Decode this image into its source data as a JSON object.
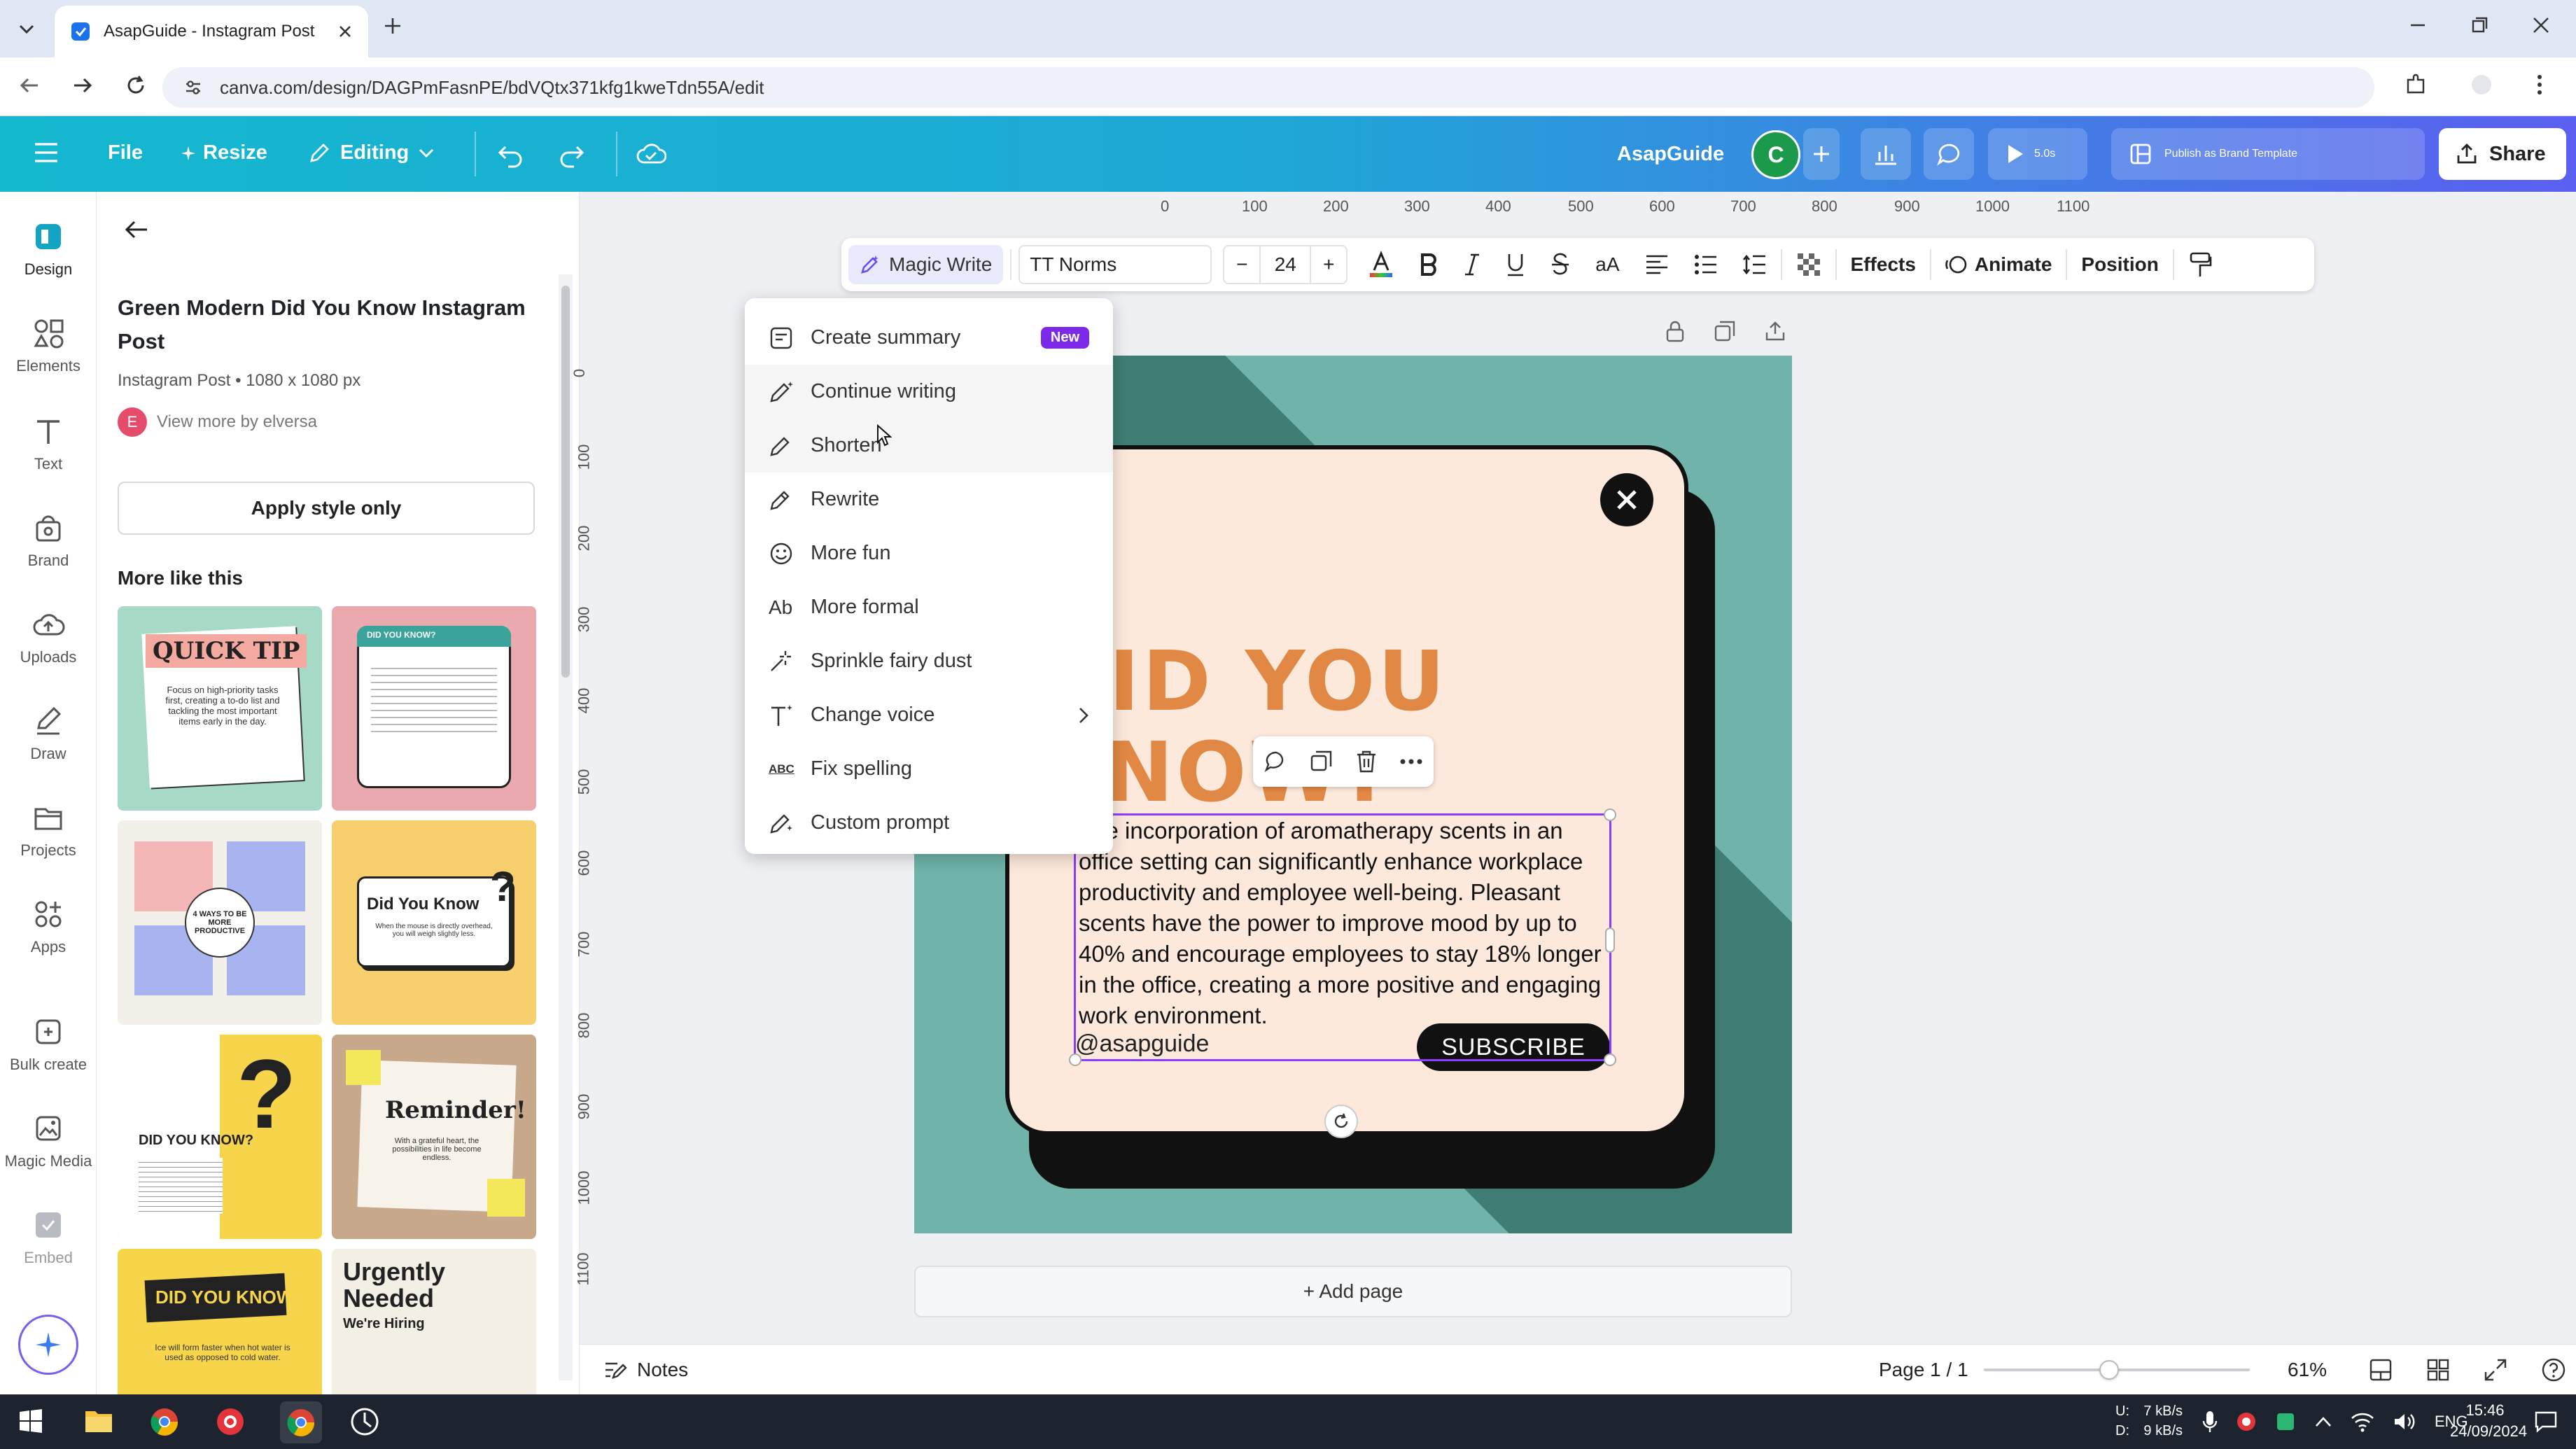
{
  "browser": {
    "tab_title": "AsapGuide - Instagram Post",
    "url": "canva.com/design/DAGPmFasnPE/bdVQtx371kfg1kweTdn55A/edit"
  },
  "header": {
    "file": "File",
    "resize": "Resize",
    "editing": "Editing",
    "brand_name": "AsapGuide",
    "avatar_letter": "C",
    "play_time": "5.0s",
    "publish": "Publish as Brand Template",
    "share": "Share"
  },
  "rail": {
    "items": [
      "Design",
      "Elements",
      "Text",
      "Brand",
      "Uploads",
      "Draw",
      "Projects",
      "Apps",
      "Bulk create",
      "Magic Media",
      "Embed"
    ]
  },
  "panel": {
    "title": "Green Modern Did You Know Instagram Post",
    "subtitle": "Instagram Post • 1080 x 1080 px",
    "author_initial": "E",
    "author": "View more by elversa",
    "apply_style": "Apply style only",
    "more_like_this": "More like this",
    "thumbs": [
      {
        "heading": "QUICK TIP",
        "body": "Focus on high-priority tasks first, creating a to-do list and tackling the most important items early in the day."
      },
      {
        "heading": "DID YOU KNOW?",
        "body": ""
      },
      {
        "heading": "4 WAYS TO BE MORE PRODUCTIVE",
        "body": ""
      },
      {
        "heading": "Did You Know",
        "body": "When the mouse is directly overhead, you will weigh slightly less."
      },
      {
        "heading": "DID YOU KNOW?",
        "body": ""
      },
      {
        "heading": "Reminder!",
        "body": "With a grateful heart, the possibilities in life become endless."
      },
      {
        "heading": "DID YOU KNOW?",
        "body": "Ice will form faster when hot water is used as opposed to cold water."
      },
      {
        "heading": "Urgently Needed",
        "body": "We're Hiring"
      }
    ]
  },
  "ruler": {
    "top": [
      "0",
      "100",
      "200",
      "300",
      "400",
      "500",
      "600",
      "700",
      "800",
      "900",
      "1000",
      "1100"
    ],
    "left": [
      "0",
      "100",
      "200",
      "300",
      "400",
      "500",
      "600",
      "700",
      "800",
      "900",
      "1000",
      "1100"
    ]
  },
  "toolbar": {
    "magic_write": "Magic Write",
    "font": "TT Norms",
    "minus": "−",
    "size": "24",
    "plus": "+",
    "case": "aA",
    "effects": "Effects",
    "animate": "Animate",
    "position": "Position"
  },
  "menu": {
    "new_badge": "New",
    "items": [
      "Create summary",
      "Continue writing",
      "Shorten",
      "Rewrite",
      "More fun",
      "More formal",
      "Sprinkle fairy dust",
      "Change voice",
      "Fix spelling",
      "Custom prompt"
    ],
    "ab_glyph": "Ab",
    "abc_glyph": "ABC"
  },
  "design": {
    "headline_1": "DID YOU",
    "headline_2": "KNOW?",
    "body": "The incorporation of aromatherapy scents in an office setting can significantly enhance workplace productivity and employee well-being. Pleasant scents have the power to improve mood by up to 40% and encourage employees to stay 18% longer in the office, creating a more positive and engaging work environment.",
    "handle": "@asapguide",
    "subscribe": "SUBSCRIBE"
  },
  "workspace": {
    "add_page": "+ Add page"
  },
  "bottombar": {
    "notes": "Notes",
    "page": "Page 1 / 1",
    "zoom": "61%",
    "zoom_level": 0.47
  },
  "taskbar": {
    "net_up": "7 kB/s",
    "net_down": "9 kB/s",
    "net_label_u": "U:",
    "net_label_d": "D:",
    "lang": "ENG",
    "time": "15:46",
    "date": "24/09/2024"
  }
}
